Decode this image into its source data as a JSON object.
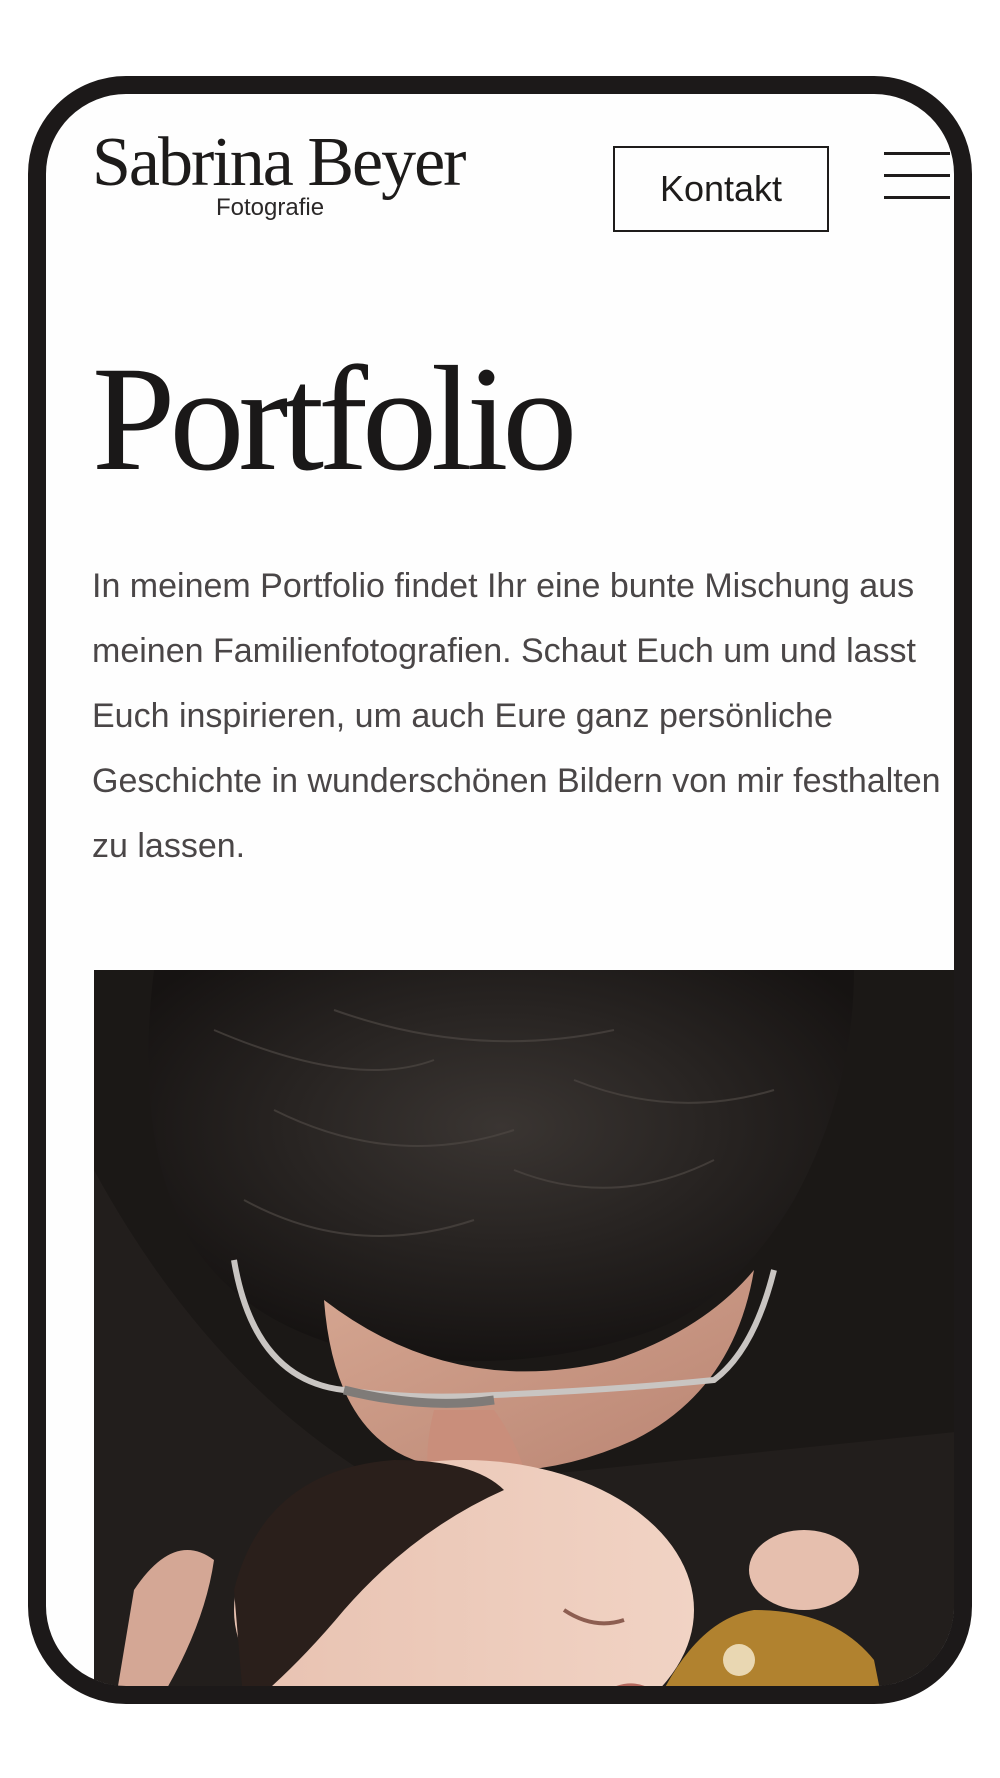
{
  "brand": {
    "name": "Sabrina Beyer",
    "tagline": "Fotografie"
  },
  "header": {
    "contact_label": "Kontakt",
    "menu_icon": "hamburger-menu-icon"
  },
  "main": {
    "title": "Portfolio",
    "intro": "In meinem Portfolio findet Ihr eine bunte Mischung aus meinen Familienfotografien. Schaut Euch um und lasst Euch inspirieren, um auch Eure ganz persönliche Geschichte in wunderschönen Bildern von mir festhalten zu lassen."
  },
  "colors": {
    "frame": "#1c1919",
    "text_dark": "#1d1b1a",
    "text_body": "#4a4647"
  }
}
